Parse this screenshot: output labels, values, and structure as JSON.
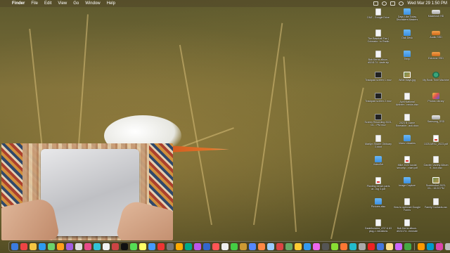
{
  "menubar": {
    "apple_glyph": "",
    "app_name": "Finder",
    "items": [
      "File",
      "Edit",
      "View",
      "Go",
      "Window",
      "Help"
    ],
    "clock": "Wed Mar 29  1:50 PM"
  },
  "desktop_icons": [
    {
      "label": "DNZ - Google Drive",
      "kind": "doc"
    },
    {
      "label": "Days Like Today Disctakers Masters",
      "kind": "folder"
    },
    {
      "label": "Macintosh HD",
      "kind": "drive"
    },
    {
      "label": "The Baseball Fan | Colorado...in Radio",
      "kind": "doc"
    },
    {
      "label": "Oak Desk",
      "kind": "folder"
    },
    {
      "label": "Audio SSD",
      "kind": "drive-orange"
    },
    {
      "label": "Bob Kerns album-d024174...kade.zip",
      "kind": "doc"
    },
    {
      "label": "Temp",
      "kind": "folder"
    },
    {
      "label": "Extreme SSD",
      "kind": "drive-orange"
    },
    {
      "label": "Trackpad screen 1.mov",
      "kind": "movie"
    },
    {
      "label": "Willie Mays.jpg",
      "kind": "img"
    },
    {
      "label": "My Book Time Machine",
      "kind": "tm"
    },
    {
      "label": "Trackpad screen 2.mov",
      "kind": "movie"
    },
    {
      "label": "April National Anthem...necks.xlsx",
      "kind": "doc"
    },
    {
      "label": "Photos Library",
      "kind": "lib"
    },
    {
      "label": "Screen Recording 2023-03-...PM.mov",
      "kind": "movie"
    },
    {
      "label": "2023 B Game Emerable...ack.docx",
      "kind": "doc"
    },
    {
      "label": "Samsung_SSD",
      "kind": "drive"
    },
    {
      "label": "Marilyn Sharer Obituary 3.docx",
      "kind": "doc"
    },
    {
      "label": "Video Libraries",
      "kind": "folder"
    },
    {
      "label": "1025-MISC_2023.pdf",
      "kind": "pdf"
    },
    {
      "label": "VideoSet",
      "kind": "folder"
    },
    {
      "label": "Mike 2022 social security....mart.pdf",
      "kind": "pdf"
    },
    {
      "label": "Garden Variety Album 9...tion.xlsx",
      "kind": "doc"
    },
    {
      "label": "Planting bench parts ar...ing 3.pdf",
      "kind": "pdf"
    },
    {
      "label": "Image Capture",
      "kind": "folder"
    },
    {
      "label": "Screenshot 2023-03-...15.22 PM",
      "kind": "img"
    },
    {
      "label": "Pictures also",
      "kind": "folder"
    },
    {
      "label": "How to optimize Google Forms",
      "kind": "doc"
    },
    {
      "label": "Family Contacts.csv",
      "kind": "doc"
    },
    {
      "label": "Danielsvarea_4'37 & 63 plug-l...berations",
      "kind": "doc"
    },
    {
      "label": "Bob Kerns album-d024174...emmale",
      "kind": "doc"
    }
  ],
  "dock_colors": [
    "#3b7be0",
    "#e44",
    "#f5c542",
    "#2d9bf0",
    "#6bd36b",
    "#ff9f1a",
    "#a25ce0",
    "#ddd",
    "#e84b8a",
    "#32c3d9",
    "#f2f2f2",
    "#c44",
    "#111",
    "#5d5",
    "#ff6",
    "#49f",
    "#e33",
    "#777",
    "#fa0",
    "#0a8",
    "#b5e",
    "#36c",
    "#f55",
    "#eee",
    "#4c4",
    "#c93",
    "#58f",
    "#f84",
    "#9cf",
    "#d44",
    "#6a6",
    "#fc3",
    "#39e",
    "#e6e",
    "#555",
    "#8d3",
    "#f73",
    "#2bc",
    "#aaa",
    "#e22",
    "#47d",
    "#fd8",
    "#c6f",
    "#4a4",
    "#f90",
    "#09c",
    "#d4a",
    "#bbb",
    "#3a3"
  ],
  "colors": {
    "menubar_bg": "rgba(80,70,40,0.55)",
    "beak": "#e0742a"
  }
}
